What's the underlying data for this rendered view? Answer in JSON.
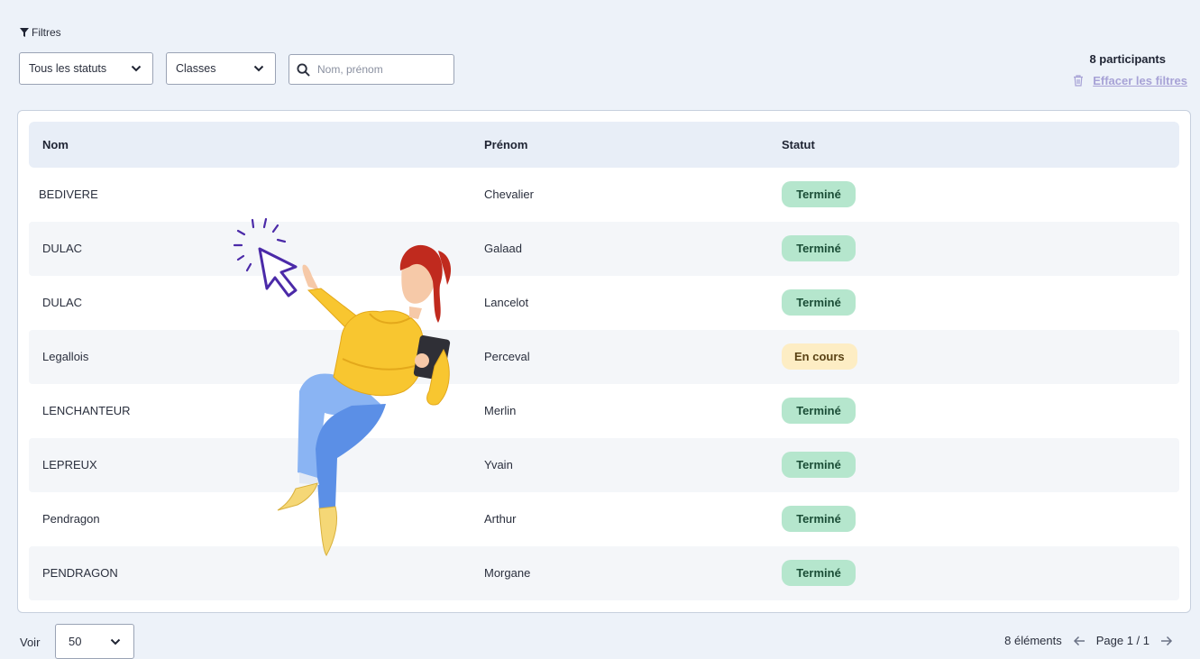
{
  "filters": {
    "title": "Filtres",
    "status_select": "Tous les statuts",
    "classes_select": "Classes",
    "search_placeholder": "Nom, prénom",
    "participants_count": "8 participants",
    "clear_label": "Effacer les filtres"
  },
  "table": {
    "headers": {
      "nom": "Nom",
      "prenom": "Prénom",
      "statut": "Statut"
    },
    "rows": [
      {
        "nom": "BEDIVERE",
        "prenom": "Chevalier",
        "statut": "Terminé"
      },
      {
        "nom": "DULAC",
        "prenom": "Galaad",
        "statut": "Terminé"
      },
      {
        "nom": "DULAC",
        "prenom": "Lancelot",
        "statut": "Terminé"
      },
      {
        "nom": "Legallois",
        "prenom": "Perceval",
        "statut": "En cours"
      },
      {
        "nom": "LENCHANTEUR",
        "prenom": "Merlin",
        "statut": "Terminé"
      },
      {
        "nom": "LEPREUX",
        "prenom": "Yvain",
        "statut": "Terminé"
      },
      {
        "nom": "Pendragon",
        "prenom": "Arthur",
        "statut": "Terminé"
      },
      {
        "nom": "PENDRAGON",
        "prenom": "Morgane",
        "statut": "Terminé"
      }
    ]
  },
  "footer": {
    "voir_label": "Voir",
    "per_page": "50",
    "elements": "8 éléments",
    "page": "Page 1 / 1"
  },
  "colors": {
    "background": "#edf2f9",
    "status_done": "#b5e6cd",
    "status_in_progress": "#fdedc4",
    "accent_link": "#a7a2d6"
  },
  "icons": [
    "filter-icon",
    "chevron-down-icon",
    "search-icon",
    "trash-icon",
    "arrow-left-icon",
    "arrow-right-icon"
  ]
}
